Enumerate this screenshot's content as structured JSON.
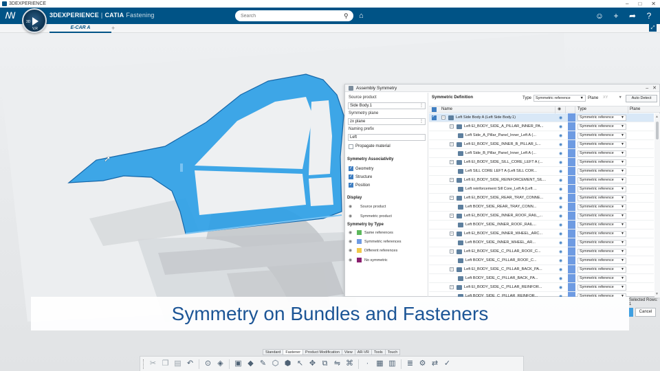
{
  "window": {
    "title": "3DEXPERIENCE",
    "controls": [
      "–",
      "□",
      "✕"
    ]
  },
  "appbar": {
    "brand_bold": "3DEXPERIENCE",
    "brand_sep": "|",
    "brand_product": "CATIA",
    "app_name": "Fastening",
    "search_placeholder": "Search"
  },
  "compass": {
    "top": "3D",
    "bottom": "V,R"
  },
  "tabs": {
    "active": "E-CAR A",
    "add": "+"
  },
  "dialog": {
    "title": "Assembly Symmetry",
    "left": {
      "source_product_label": "Source product",
      "source_product_value": "Side Body.1",
      "symmetry_plane_label": "Symmetry plane",
      "symmetry_plane_value": "zx plane",
      "naming_prefix_label": "Naming prefix",
      "naming_prefix_value": "Left",
      "propagate_material": "Propagate material",
      "assoc_title": "Symmetry Associativity",
      "assoc_items": [
        "Geometry",
        "Structure",
        "Position"
      ],
      "display_title": "Display",
      "display_items": [
        "Source product",
        "Symmetric product"
      ],
      "by_type_title": "Symmetry by Type",
      "by_type_items": [
        "Same references",
        "Symmetric references",
        "Different references",
        "No symmetric"
      ],
      "colors": {
        "same": "#5cb85c",
        "symmetric": "#6e9be2",
        "different": "#f0c84a",
        "none": "#8a1f6e"
      }
    },
    "right": {
      "title": "Symmetric Definition",
      "type_label": "Type",
      "type_value": "Symmetric reference",
      "plane_label": "Plane",
      "plane_value": "XY",
      "auto_detect": "Auto Detect",
      "col_name": "Name",
      "col_type": "Type",
      "col_plane": "Plane",
      "rows": [
        {
          "level": 0,
          "text": "Left Side Body A (Left Side Body.1)",
          "toggle": "–",
          "type": "Symmetric reference",
          "selected": true
        },
        {
          "level": 1,
          "text": "Left El_BODY_SIDE_A_PILLAR_INNER_PA...",
          "toggle": "–",
          "type": "Symmetric reference"
        },
        {
          "level": 2,
          "text": "Left Side_A_Pillar_Panel_Inner_Left A (...",
          "toggle": "",
          "type": "Symmetric reference"
        },
        {
          "level": 1,
          "text": "Left El_BODY_SIDE_INNER_B_PILLAR_L...",
          "toggle": "–",
          "type": "Symmetric reference"
        },
        {
          "level": 2,
          "text": "Left Side_B_Pillar_Panel_Inner_Left A (...",
          "toggle": "",
          "type": "Symmetric reference"
        },
        {
          "level": 1,
          "text": "Left El_BODY_SIDE_SILL_CORE_LEFT A (...",
          "toggle": "–",
          "type": "Symmetric reference"
        },
        {
          "level": 2,
          "text": "Left SILL CORE LEFT A (Left SILL COR...",
          "toggle": "",
          "type": "Symmetric reference"
        },
        {
          "level": 1,
          "text": "Left El_BODY_SIDE_REINFORCEMENT_SIL...",
          "toggle": "–",
          "type": "Symmetric reference"
        },
        {
          "level": 2,
          "text": "Left reinforcement Sill Core_Left A (Left ...",
          "toggle": "",
          "type": "Symmetric reference"
        },
        {
          "level": 1,
          "text": "Left El_BODY_SIDE_REAR_TRAY_CONNE...",
          "toggle": "–",
          "type": "Symmetric reference"
        },
        {
          "level": 2,
          "text": "Left BODY_SIDE_REAR_TRAY_CONN...",
          "toggle": "",
          "type": "Symmetric reference"
        },
        {
          "level": 1,
          "text": "Left El_BODY_SIDE_INNER_ROOF_RAIL_...",
          "toggle": "–",
          "type": "Symmetric reference"
        },
        {
          "level": 2,
          "text": "Left BODY_SIDE_INNER_ROOF_RAIL...",
          "toggle": "",
          "type": "Symmetric reference"
        },
        {
          "level": 1,
          "text": "Left El_BODY_SIDE_INNER_WHEEL_ARC...",
          "toggle": "–",
          "type": "Symmetric reference"
        },
        {
          "level": 2,
          "text": "Left BODY_SIDE_INNER_WHEEL_AR...",
          "toggle": "",
          "type": "Symmetric reference"
        },
        {
          "level": 1,
          "text": "Left El_BODY_SIDE_C_PILLAR_ROOF_C...",
          "toggle": "–",
          "type": "Symmetric reference"
        },
        {
          "level": 2,
          "text": "Left BODY_SIDE_C_PILLAR_ROOF_C...",
          "toggle": "",
          "type": "Symmetric reference"
        },
        {
          "level": 1,
          "text": "Left El_BODY_SIDE_C_PILLAR_BACK_PA...",
          "toggle": "–",
          "type": "Symmetric reference"
        },
        {
          "level": 2,
          "text": "Left BODY_SIDE_C_PILLAR_BACK_PA...",
          "toggle": "",
          "type": "Symmetric reference"
        },
        {
          "level": 1,
          "text": "Left El_BODY_SIDE_C_PILLAR_REINFOR...",
          "toggle": "–",
          "type": "Symmetric reference"
        },
        {
          "level": 2,
          "text": "Left BODY_SIDE_C_PILLAR_REINFOR...",
          "toggle": "",
          "type": "Symmetric reference"
        }
      ]
    },
    "footer": {
      "selected_rows": "Selected Rows: 1",
      "cancel": "Cancel"
    }
  },
  "caption": "Symmetry on Bundles and Fasteners",
  "toolbar_tabs": [
    "Standard",
    "Fastener",
    "Product Modification",
    "View",
    "AR-VR",
    "Tools",
    "Touch"
  ],
  "toolbar_active_tab": "Fastener",
  "toolbar_tools": [
    "cut-icon",
    "copy-icon",
    "paste-icon",
    "undo-icon",
    "fit-all-icon",
    "material-icon",
    "product-icon",
    "part-icon",
    "sketch-icon",
    "shape-icon",
    "assembly-icon",
    "cursor-icon",
    "compass-icon",
    "fastener-icon",
    "symmetry-icon",
    "bundle-icon",
    "point-icon",
    "table-icon",
    "grid-icon",
    "spec-icon",
    "settings-icon",
    "translate-icon",
    "review-icon"
  ]
}
